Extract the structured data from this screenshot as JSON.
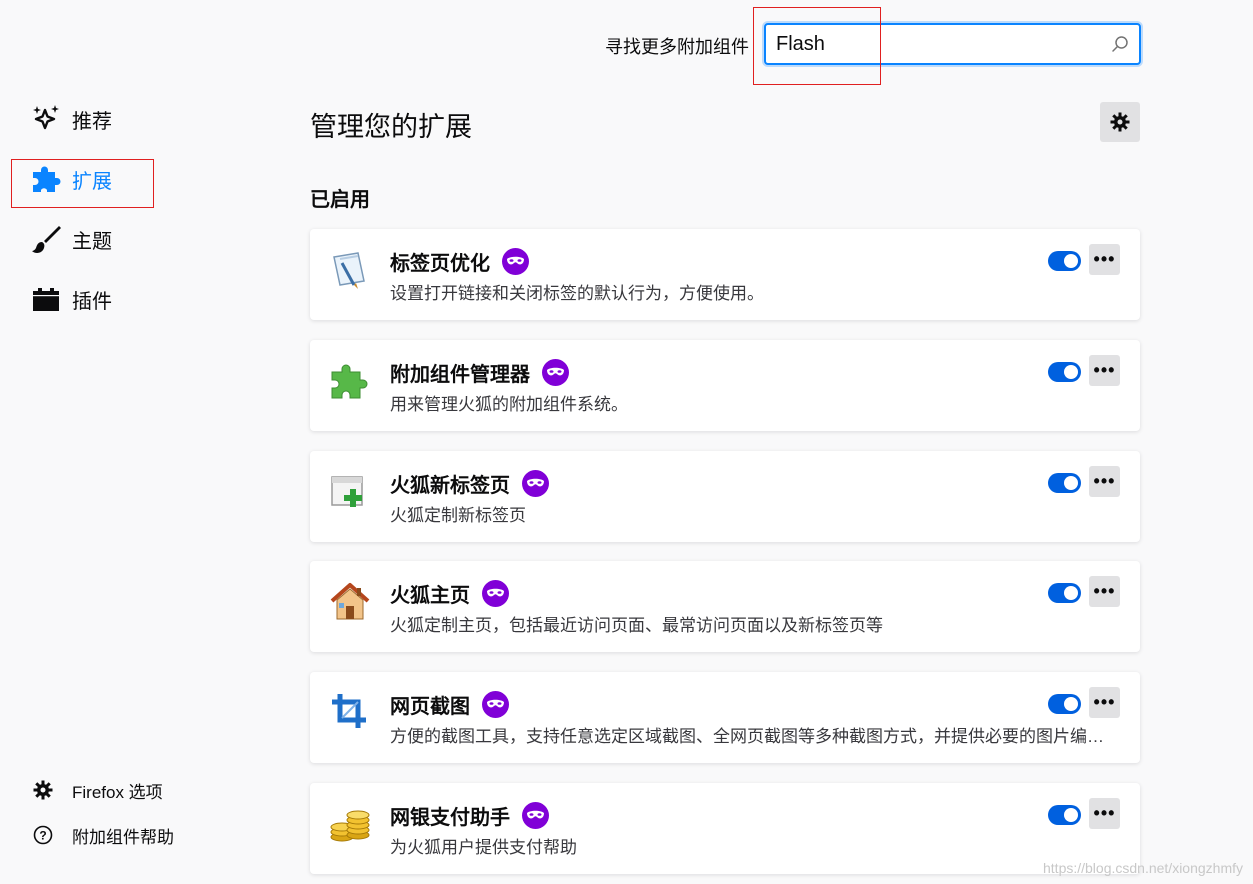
{
  "search": {
    "label": "寻找更多附加组件",
    "value": "Flash"
  },
  "sidebar": {
    "items": [
      {
        "label": "推荐",
        "icon": "sparkle-icon"
      },
      {
        "label": "扩展",
        "icon": "puzzle-icon",
        "active": true
      },
      {
        "label": "主题",
        "icon": "brush-icon"
      },
      {
        "label": "插件",
        "icon": "plugin-block-icon"
      }
    ],
    "footer": [
      {
        "label": "Firefox 选项",
        "icon": "gear-icon"
      },
      {
        "label": "附加组件帮助",
        "icon": "help-icon"
      }
    ]
  },
  "main": {
    "title": "管理您的扩展",
    "section": "已启用",
    "addons": [
      {
        "name": "标签页优化",
        "desc": "设置打开链接和关闭标签的默认行为，方便使用。",
        "icon": "tab-utilities-icon",
        "enabled": true
      },
      {
        "name": "附加组件管理器",
        "desc": "用来管理火狐的附加组件系统。",
        "icon": "puzzle-green-icon",
        "enabled": true
      },
      {
        "name": "火狐新标签页",
        "desc": "火狐定制新标签页",
        "icon": "new-tab-icon",
        "enabled": true
      },
      {
        "name": "火狐主页",
        "desc": "火狐定制主页，包括最近访问页面、最常访问页面以及新标签页等",
        "icon": "house-icon",
        "enabled": true
      },
      {
        "name": "网页截图",
        "desc": "方便的截图工具，支持任意选定区域截图、全网页截图等多种截图方式，并提供必要的图片编辑功能",
        "icon": "crop-icon",
        "enabled": true
      },
      {
        "name": "网银支付助手",
        "desc": "为火狐用户提供支付帮助",
        "icon": "coins-icon",
        "enabled": true
      }
    ]
  },
  "colors": {
    "accent": "#0a84ff",
    "toggle_on": "#0060df",
    "private_badge": "#8000d7",
    "highlight": "#e02020"
  },
  "watermark": "https://blog.csdn.net/xiongzhmfy"
}
